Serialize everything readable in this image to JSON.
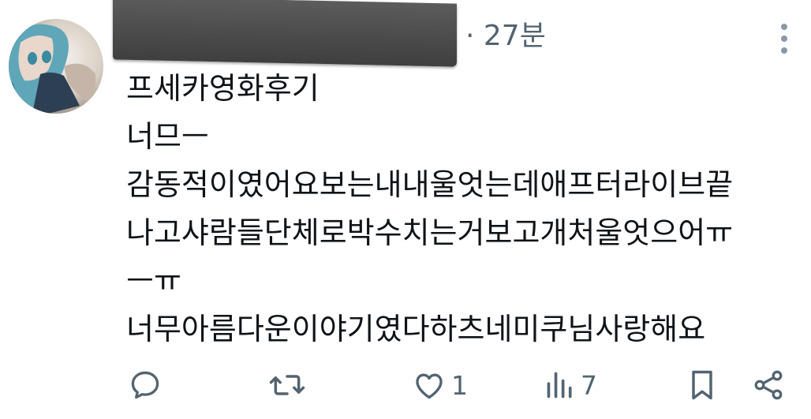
{
  "header": {
    "time": "· 27분"
  },
  "post": {
    "lines": [
      "프세카영화후기",
      "너므ㅡ",
      "감동적이였어요보는내내울엇는데애프터라이브끝",
      "나고샤람들단체로박수치는거보고개처울엇으어ㅠ",
      "ㅡㅠ",
      "너무아름다운이야기였다하츠네미쿠님사랑해요"
    ]
  },
  "actions": {
    "reply_count": "",
    "retweet_count": "",
    "like_count": "1",
    "views_count": "7"
  },
  "colors": {
    "text": "#0f1419",
    "secondary": "#536471",
    "redaction": "#4a4a4a"
  }
}
